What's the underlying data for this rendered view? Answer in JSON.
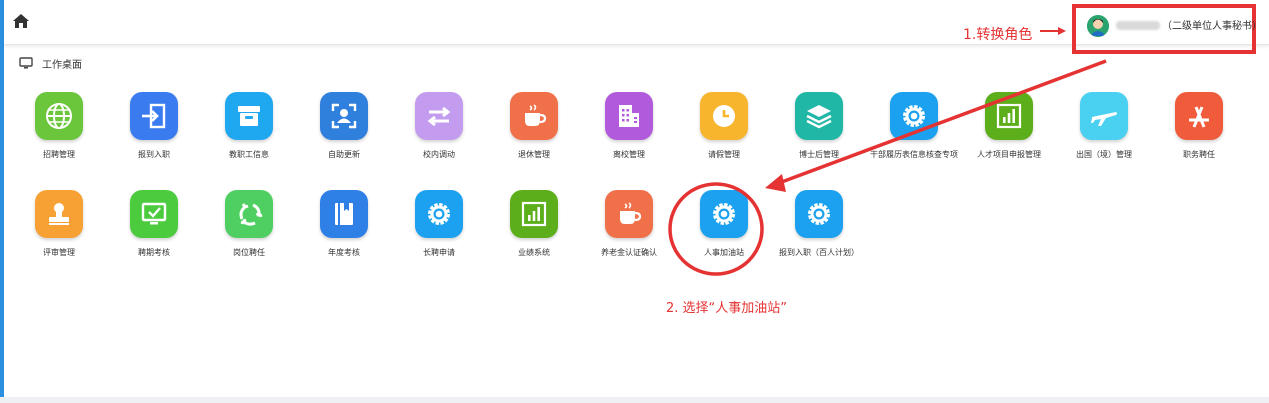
{
  "header": {
    "role_label": "（二级单位人事秘书）",
    "chevron": "⌄"
  },
  "breadcrumb": {
    "label": "工作桌面"
  },
  "annotations": {
    "step1": "1.转换角色",
    "step2": "2. 选择“人事加油站”"
  },
  "apps": [
    {
      "label": "招聘管理",
      "color": "#6cc63c",
      "icon": "globe-icon"
    },
    {
      "label": "报到入职",
      "color": "#3a7cf0",
      "icon": "login-icon"
    },
    {
      "label": "教职工信息",
      "color": "#1fa8f0",
      "icon": "archive-icon"
    },
    {
      "label": "自助更新",
      "color": "#2f7fdc",
      "icon": "scan-user-icon"
    },
    {
      "label": "校内调动",
      "color": "#c39cf0",
      "icon": "swap-icon"
    },
    {
      "label": "退休管理",
      "color": "#f0704a",
      "icon": "coffee-icon"
    },
    {
      "label": "离校管理",
      "color": "#b15bdc",
      "icon": "building-icon"
    },
    {
      "label": "请假管理",
      "color": "#f7b52e",
      "icon": "clock-icon"
    },
    {
      "label": "博士后管理",
      "color": "#20b7a6",
      "icon": "layers-icon"
    },
    {
      "label": "干部履历表信息核查专项",
      "color": "#1ba1ef",
      "icon": "gear-icon"
    },
    {
      "label": "人才项目申报管理",
      "color": "#5cae1a",
      "icon": "bar-chart-icon"
    },
    {
      "label": "出国（境）管理",
      "color": "#4ad0f0",
      "icon": "airplane-icon"
    },
    {
      "label": "职务聘任",
      "color": "#f05b3b",
      "icon": "appstore-icon"
    },
    {
      "label": "评审管理",
      "color": "#f7a034",
      "icon": "stamp-icon"
    },
    {
      "label": "聘期考核",
      "color": "#4ccb3e",
      "icon": "monitor-check-icon"
    },
    {
      "label": "岗位聘任",
      "color": "#4fcf62",
      "icon": "recycle-icon"
    },
    {
      "label": "年度考核",
      "color": "#2f80e6",
      "icon": "book-icon"
    },
    {
      "label": "长聘申请",
      "color": "#1ba1ef",
      "icon": "gear-icon"
    },
    {
      "label": "业绩系统",
      "color": "#5cae1a",
      "icon": "bar-chart-icon"
    },
    {
      "label": "养老金认证确认",
      "color": "#f0704a",
      "icon": "coffee-icon"
    },
    {
      "label": "人事加油站",
      "color": "#1ba1ef",
      "icon": "gear-icon"
    },
    {
      "label": "报到入职（百人计划）",
      "color": "#1ba1ef",
      "icon": "gear-icon"
    }
  ]
}
